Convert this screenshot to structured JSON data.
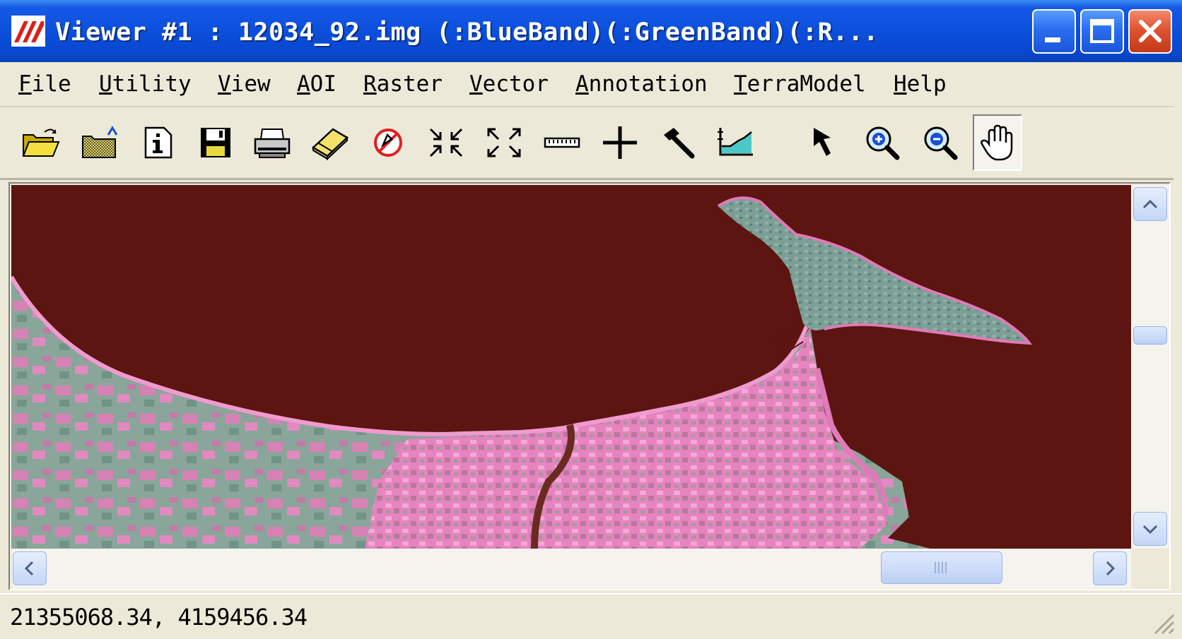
{
  "window": {
    "title": "Viewer #1 : 12034_92.img (:BlueBand)(:GreenBand)(:R...",
    "buttons": {
      "minimize": "minimize",
      "maximize": "maximize",
      "close": "close"
    }
  },
  "menubar": {
    "items": [
      {
        "mnemonic": "F",
        "rest": "ile"
      },
      {
        "mnemonic": "U",
        "rest": "tility"
      },
      {
        "mnemonic": "V",
        "rest": "iew"
      },
      {
        "mnemonic": "A",
        "rest": "OI"
      },
      {
        "mnemonic": "R",
        "rest": "aster"
      },
      {
        "mnemonic": "V",
        "rest": "ector"
      },
      {
        "mnemonic": "A",
        "rest": "nnotation"
      },
      {
        "mnemonic": "T",
        "rest": "erraModel"
      },
      {
        "mnemonic": "H",
        "rest": "elp"
      }
    ]
  },
  "toolbar": {
    "icons": [
      "open-folder-icon",
      "open-layer-icon",
      "info-icon",
      "save-icon",
      "print-icon",
      "eraser-icon",
      "clear-view-icon",
      "fit-in-icon",
      "full-extent-icon",
      "measure-ruler-icon",
      "inquire-cursor-icon",
      "hammer-icon",
      "profile-icon",
      "select-arrow-icon",
      "zoom-in-icon",
      "zoom-out-icon",
      "pan-hand-icon"
    ],
    "active_tool": "pan-hand-icon"
  },
  "status": {
    "coordinates": "21355068.34,  4159456.34"
  },
  "colors": {
    "water": "#5e1410",
    "land_pink": "#e87ab8",
    "land_green": "#7aa89a",
    "title_blue": "#0a47cf"
  }
}
